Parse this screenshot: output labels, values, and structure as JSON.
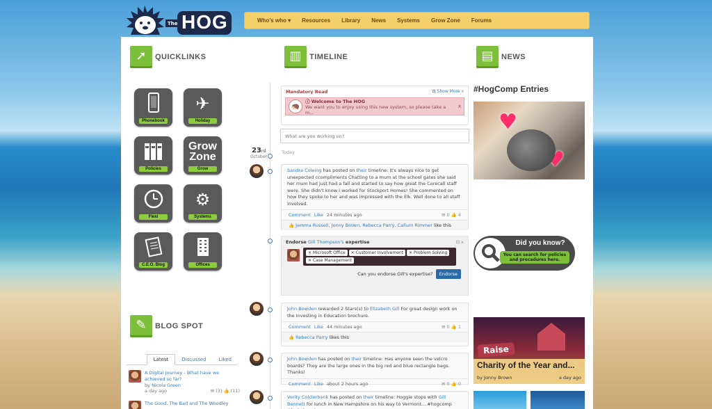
{
  "brand": {
    "the": "The",
    "name": "HOG"
  },
  "nav": [
    "Who's who ▾",
    "Resources",
    "Library",
    "News",
    "Systems",
    "Grow Zone",
    "Forums"
  ],
  "quicklinks": {
    "title": "QUICKLINKS",
    "items": [
      {
        "label": "Phonebook",
        "icon": "phone-icon"
      },
      {
        "label": "Holiday",
        "icon": "airplane-icon"
      },
      {
        "label": "Policies",
        "icon": "binders-icon"
      },
      {
        "label": "Grow",
        "icon": "grow-zone-icon",
        "glyph": "Grow Zone"
      },
      {
        "label": "Flexi",
        "icon": "clock-icon"
      },
      {
        "label": "Systems",
        "icon": "gear-icon"
      },
      {
        "label": "C.E.O. Blog",
        "icon": "document-icon"
      },
      {
        "label": "Offices",
        "icon": "building-icon"
      }
    ]
  },
  "blog": {
    "title": "BLOG SPOT",
    "tabs": [
      "Latest",
      "Discussed",
      "Liked"
    ],
    "items": [
      {
        "title": "A Digital Journey - What have we achieved so far?",
        "by": "by",
        "author": "Nicola Green",
        "age": "a day ago",
        "comments": "(3)",
        "likes": "(11)"
      },
      {
        "title": "The Good, The Bad and The Woodley"
      }
    ]
  },
  "timeline": {
    "title": "TIMELINE",
    "mandatory": {
      "heading": "Mandatory Read",
      "show_more": "Show More",
      "close": "x",
      "title": "Welcome to The HOG",
      "text": "We want you to enjoy using this new system, so please take a m...",
      "dismiss": "x"
    },
    "composer_placeholder": "What are you working on?",
    "date": {
      "day": "23",
      "suffix": "rd",
      "month": "October"
    },
    "today": "Today",
    "posts": [
      {
        "author": "Sandra Coleing",
        "verb": "has posted on",
        "target": "their",
        "tail": "timeline: It's always nice to get unexpected ccompliments Chatting to a mum at the school gates she said her mum had just had a fall and started to say how great the Corecall staff were. She didn't know I worked for Stockport Homes! She commented on how they spoke to her and was impressed with the Elk. Well done to all staff involved.",
        "comment": "Comment",
        "like": "Like",
        "age": "24 minutes ago",
        "comments": "0",
        "likes": "4",
        "likers": "Jemma Russell, Jonny Brown, Rebecca Parry, Callum Rimmer",
        "like_tail": "like this"
      },
      {
        "author": "John Bowden",
        "verb": "rewarded 2 Stars(s) to",
        "target": "Elizabeth Gill",
        "tail": "For great design work on the Investing in Education brochure.",
        "comment": "Comment",
        "like": "Like",
        "age": "44 minutes ago",
        "comments": "0",
        "likes": "1",
        "likers": "Rebecca Parry",
        "like_tail": "likes this"
      },
      {
        "author": "John Bowden",
        "verb": "has posted on",
        "target": "their",
        "tail": "timeline: Has anyone seen the velcro boards? They are the large ones in the big red and blue rectangle bags. Thanks!",
        "comment": "Comment",
        "like": "Like",
        "age": "about 2 hours ago",
        "comments": "0",
        "likes": "0"
      },
      {
        "author": "Verity Colclerbank",
        "verb": "has posted on",
        "target": "their",
        "tail": "timeline: Hoggie stops with",
        "mention": "Gill Bennett",
        "tail2": "for lunch in New Hampshire on his way to Vermont....#hogcomp #luckyhoggie"
      }
    ],
    "endorse": {
      "prefix": "Endorse",
      "person": "Gill Thompson's",
      "suffix": "expertise",
      "skills": [
        "Microsoft Office",
        "Customer Involvement",
        "Problem Solving",
        "Case Management"
      ],
      "question": "Can you endorse Gill's expertise?",
      "button": "Endorse"
    }
  },
  "news": {
    "title": "NEWS",
    "heading": "#HogComp Entries",
    "dyk": {
      "title": "Did you know?",
      "text": "You can search for policies and procedures here."
    },
    "charity": {
      "headline": "Charity of the Year and...",
      "author": "by Jonny Brown",
      "age": "a day ago",
      "sign": "Raise"
    }
  }
}
